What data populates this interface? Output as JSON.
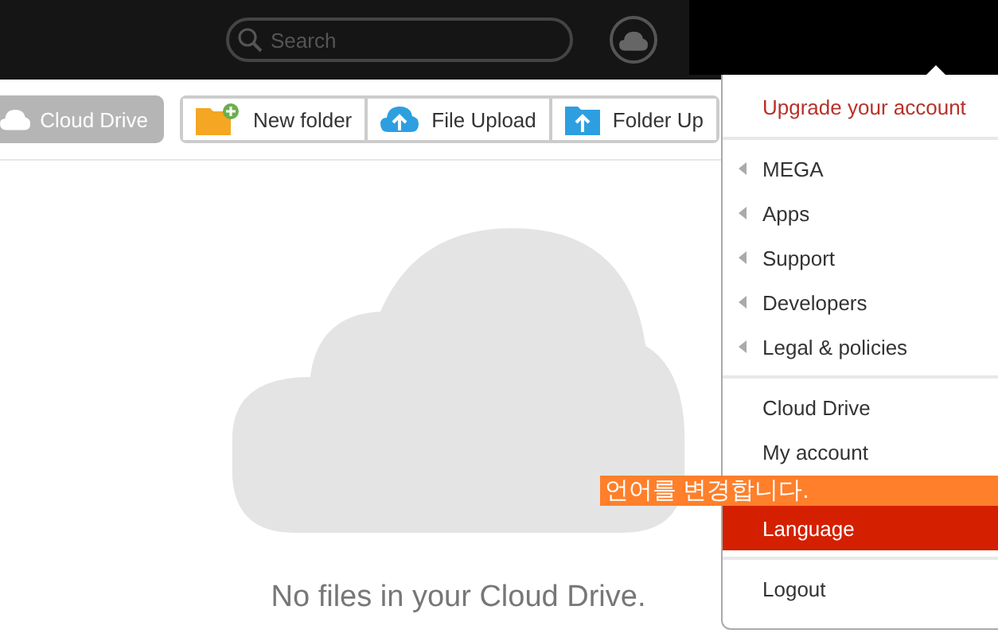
{
  "top_bar": {
    "search": {
      "placeholder": "Search"
    }
  },
  "toolbar": {
    "location": "Cloud Drive",
    "buttons": [
      {
        "label": "New folder",
        "kind": "new-folder"
      },
      {
        "label": "File Upload",
        "kind": "file-upload"
      },
      {
        "label": "Folder Up",
        "kind": "folder-upload"
      }
    ]
  },
  "empty_state": {
    "message": "No files in your Cloud Drive."
  },
  "menu": {
    "sections": [
      [
        {
          "label": "Upgrade your account",
          "kind": "upgrade",
          "selected": false
        }
      ],
      [
        {
          "label": "MEGA",
          "kind": "submenu",
          "selected": false
        },
        {
          "label": "Apps",
          "kind": "submenu",
          "selected": false
        },
        {
          "label": "Support",
          "kind": "submenu",
          "selected": false
        },
        {
          "label": "Developers",
          "kind": "submenu",
          "selected": false
        },
        {
          "label": "Legal & policies",
          "kind": "submenu",
          "selected": false
        }
      ],
      [
        {
          "label": "Cloud Drive",
          "kind": "link",
          "selected": false
        },
        {
          "label": "My account",
          "kind": "link",
          "selected": false
        },
        {
          "label": "Language",
          "kind": "link",
          "selected": true
        }
      ],
      [
        {
          "label": "Logout",
          "kind": "link",
          "selected": false
        }
      ]
    ]
  },
  "callout": {
    "text": "언어를 변경합니다."
  }
}
